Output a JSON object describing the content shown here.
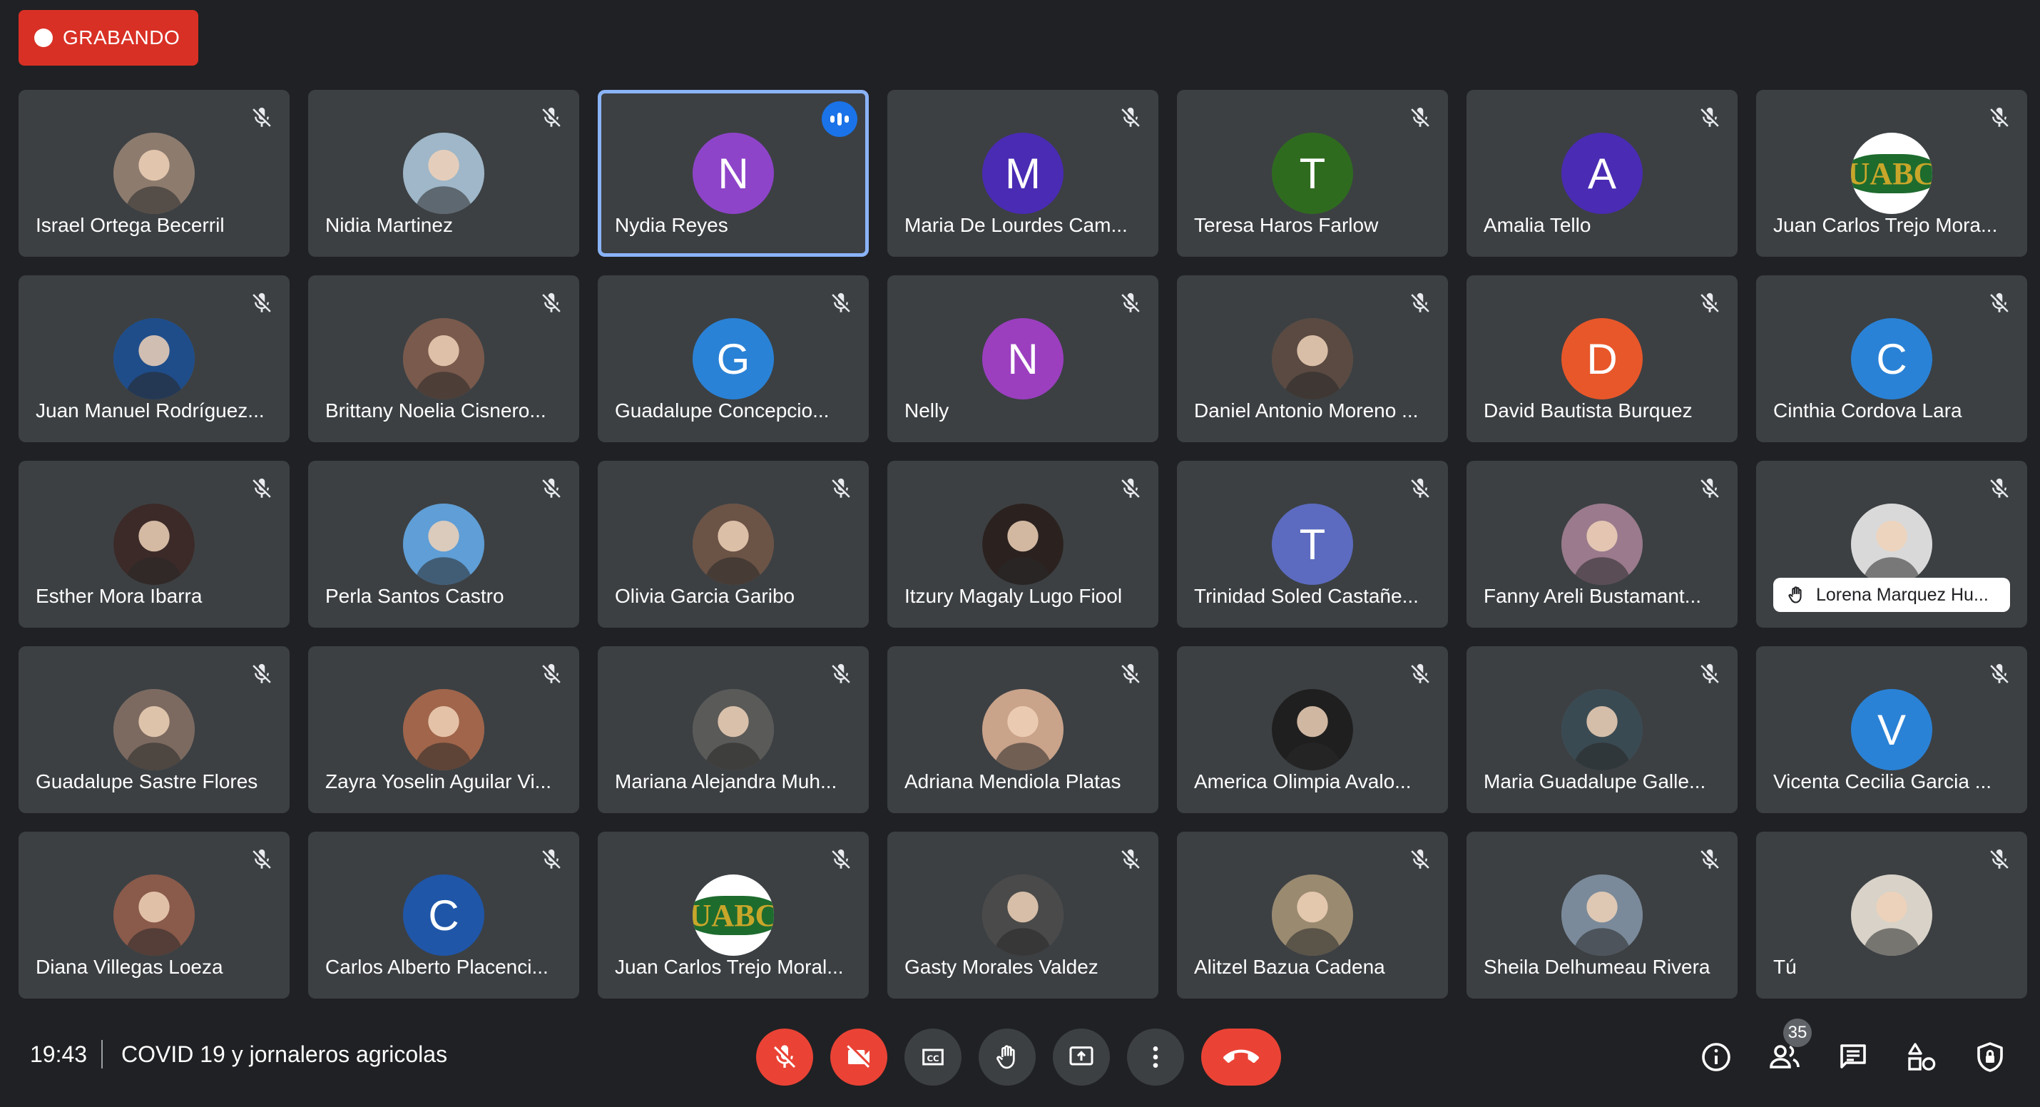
{
  "recording": {
    "label": "GRABANDO"
  },
  "participants": [
    {
      "name": "Israel Ortega Becerril",
      "avatar": "photo",
      "color": "#8d7b6e"
    },
    {
      "name": "Nidia Martinez",
      "avatar": "photo",
      "color": "#9fb7c8"
    },
    {
      "name": "Nydia Reyes",
      "avatar": "N",
      "color": "#8e44c9",
      "speaking": true
    },
    {
      "name": "Maria De Lourdes Cam...",
      "avatar": "M",
      "color": "#4a2bb3"
    },
    {
      "name": "Teresa Haros Farlow",
      "avatar": "T",
      "color": "#2f6b1f"
    },
    {
      "name": "Amalia Tello",
      "avatar": "A",
      "color": "#4a2bb3"
    },
    {
      "name": "Juan Carlos Trejo Mora...",
      "avatar": "logo",
      "color": "#ffffff",
      "logo_text": "UABC"
    },
    {
      "name": "Juan Manuel Rodríguez...",
      "avatar": "photo",
      "color": "#1f4d8a"
    },
    {
      "name": "Brittany Noelia Cisnero...",
      "avatar": "photo",
      "color": "#7a5a4c"
    },
    {
      "name": "Guadalupe Concepcio...",
      "avatar": "G",
      "color": "#2a82d6"
    },
    {
      "name": "Nelly",
      "avatar": "N",
      "color": "#9b3fbf"
    },
    {
      "name": "Daniel Antonio Moreno ...",
      "avatar": "photo",
      "color": "#5a4a42"
    },
    {
      "name": "David Bautista Burquez",
      "avatar": "D",
      "color": "#e8572a"
    },
    {
      "name": "Cinthia Cordova Lara",
      "avatar": "C",
      "color": "#2a82d6"
    },
    {
      "name": "Esther Mora Ibarra",
      "avatar": "photo",
      "color": "#3b2a28"
    },
    {
      "name": "Perla Santos Castro",
      "avatar": "photo",
      "color": "#5f9ed6"
    },
    {
      "name": "Olivia Garcia Garibo",
      "avatar": "photo",
      "color": "#6b5346"
    },
    {
      "name": "Itzury Magaly Lugo Fiool",
      "avatar": "photo",
      "color": "#2b2220"
    },
    {
      "name": "Trinidad Soled Castañe...",
      "avatar": "T",
      "color": "#5c6bc0"
    },
    {
      "name": "Fanny Areli Bustamant...",
      "avatar": "photo",
      "color": "#9a7a8c"
    },
    {
      "name": "Lorena Marquez Hu...",
      "avatar": "photo",
      "color": "#d9d9d9",
      "hand_raised": true
    },
    {
      "name": "Guadalupe Sastre Flores",
      "avatar": "photo",
      "color": "#7c6a60"
    },
    {
      "name": "Zayra Yoselin Aguilar Vi...",
      "avatar": "photo",
      "color": "#a0654a"
    },
    {
      "name": "Mariana Alejandra Muh...",
      "avatar": "photo",
      "color": "#5a5a58"
    },
    {
      "name": "Adriana Mendiola Platas",
      "avatar": "photo",
      "color": "#c9a38a"
    },
    {
      "name": "America Olimpia Avalo...",
      "avatar": "photo",
      "color": "#1f1f1f"
    },
    {
      "name": "Maria Guadalupe Galle...",
      "avatar": "photo",
      "color": "#3a4a52"
    },
    {
      "name": "Vicenta Cecilia Garcia ...",
      "avatar": "V",
      "color": "#2a82d6"
    },
    {
      "name": "Diana Villegas Loeza",
      "avatar": "photo",
      "color": "#8a5a4a"
    },
    {
      "name": "Carlos Alberto Placenci...",
      "avatar": "C",
      "color": "#1f56a8"
    },
    {
      "name": "Juan Carlos Trejo Moral...",
      "avatar": "logo",
      "color": "#ffffff",
      "logo_text": "UABC"
    },
    {
      "name": "Gasty Morales Valdez",
      "avatar": "photo",
      "color": "#4a4a4a"
    },
    {
      "name": "Alitzel Bazua Cadena",
      "avatar": "photo",
      "color": "#9a8a70"
    },
    {
      "name": "Sheila Delhumeau Rivera",
      "avatar": "photo",
      "color": "#7a8a9a"
    },
    {
      "name": "Tú",
      "avatar": "photo",
      "color": "#d8d2c8"
    }
  ],
  "bottom_bar": {
    "time": "19:43",
    "meeting_title": "COVID 19 y jornaleros agricolas",
    "controls": [
      "mic-off-icon",
      "camera-off-icon",
      "captions-icon",
      "raise-hand-icon",
      "present-screen-icon",
      "more-options-icon",
      "end-call-icon"
    ],
    "right_icons": [
      "info-icon",
      "people-icon",
      "chat-icon",
      "activities-icon",
      "host-controls-icon"
    ],
    "people_count": "35"
  },
  "colors": {
    "background": "#202124",
    "tile": "#3c4043",
    "danger": "#ea4335",
    "speaking_border": "#8ab4f8"
  }
}
